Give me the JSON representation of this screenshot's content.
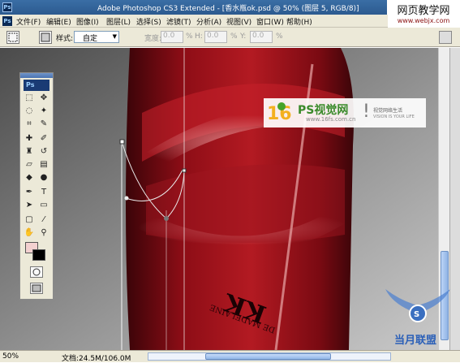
{
  "window": {
    "title": "Adobe Photoshop CS3 Extended - [香水瓶ok.psd @ 50% (图层 5, RGB/8)]",
    "app_icon": "Ps"
  },
  "watermark_top": {
    "line1": "网页教学网",
    "line2": "www.webjx.com"
  },
  "menu": [
    "文件(F)",
    "编辑(E)",
    "图像(I)",
    "图层(L)",
    "选择(S)",
    "滤镜(T)",
    "分析(A)",
    "视图(V)",
    "窗口(W)",
    "帮助(H)"
  ],
  "options": {
    "style_label": "样式:",
    "style_value": "自定",
    "width_label": "宽度:",
    "width_value": "0.0",
    "width_unit": "%",
    "height_label": "H:",
    "height_value": "0.0",
    "height_unit": "%",
    "depth_label": "Y:",
    "depth_value": "0.0",
    "depth_unit": "%"
  },
  "toolbox": {
    "logo": "Ps",
    "type_tool": "T"
  },
  "logo_overlay": {
    "name": "PS视觉网",
    "url": "www.16fs.com.cn",
    "small1": "视觉网络生活",
    "small2": "VISION IS YOUR LIFE"
  },
  "canvas_text": {
    "bottle_label": "KK",
    "bottle_small": "DE MADELAINE"
  },
  "status": {
    "zoom": "50%",
    "doc": "文档:24.5M/106.0M"
  },
  "watermark_bottom": {
    "text": "当月联盟"
  },
  "colors": {
    "foreground": "#f3d0d0",
    "background": "#000000",
    "accent": "#3a6ea5"
  }
}
